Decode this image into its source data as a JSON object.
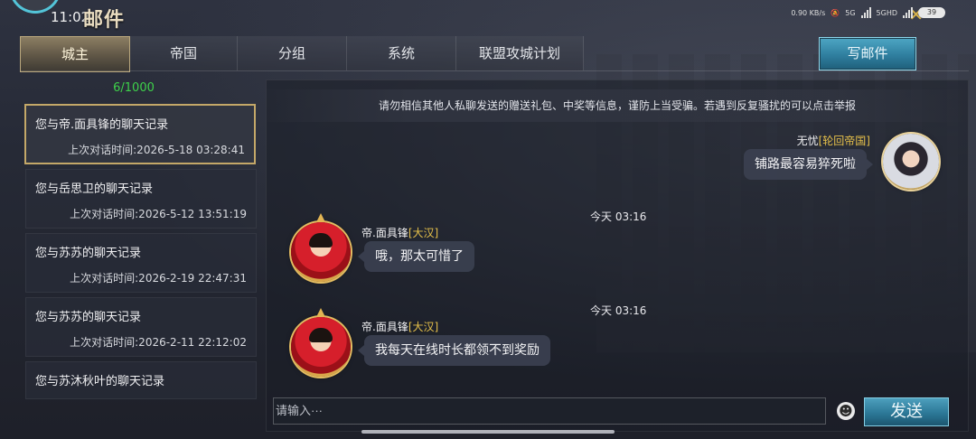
{
  "status_bar": {
    "time": "11:02",
    "net_speed": "0.90 KB/s",
    "net_5g": "5G",
    "net_5g_hd": "5GHD",
    "battery": "39"
  },
  "app": {
    "title": "邮件"
  },
  "tabs": [
    {
      "label": "城主",
      "active": true
    },
    {
      "label": "帝国",
      "active": false
    },
    {
      "label": "分组",
      "active": false
    },
    {
      "label": "系统",
      "active": false
    },
    {
      "label": "联盟攻城计划",
      "active": false
    }
  ],
  "write_mail_label": "写邮件",
  "mail_count": "6/1000",
  "threads": [
    {
      "title": "您与帝.面具锋的聊天记录",
      "time": "上次对话时间:2026-5-18   03:28:41",
      "active": true
    },
    {
      "title": "您与岳思卫的聊天记录",
      "time": "上次对话时间:2026-5-12   13:51:19",
      "active": false
    },
    {
      "title": "您与苏苏的聊天记录",
      "time": "上次对话时间:2026-2-19   22:47:31",
      "active": false
    },
    {
      "title": "您与苏苏的聊天记录",
      "time": "上次对话时间:2026-2-11   22:12:02",
      "active": false
    },
    {
      "title": "您与苏沐秋叶的聊天记录",
      "time": "",
      "active": false
    }
  ],
  "notice": "请勿相信其他人私聊发送的赠送礼包、中奖等信息，谨防上当受骗。若遇到反复骚扰的可以点击举报",
  "messages": [
    {
      "timestamp": "今天 03:16",
      "sender": "无忧",
      "tag": "[轮回帝国]",
      "text": "铺路最容易猝死啦",
      "side": "right"
    },
    {
      "timestamp": "今天 03:16",
      "sender": "帝.面具锋",
      "tag": "[大汉]",
      "text": "哦，那太可惜了",
      "side": "left"
    },
    {
      "timestamp": "今天 03:16",
      "sender": "帝.面具锋",
      "tag": "[大汉]",
      "text": "我每天在线时长都领不到奖励",
      "side": "left"
    }
  ],
  "input": {
    "placeholder": "请输入···",
    "value": ""
  },
  "send_label": "发送",
  "emoji_icon": "emoji-icon",
  "colors": {
    "accent_gold": "#c4a868",
    "button_blue": "#2f7f9f",
    "count_green": "#3ed14a",
    "tag_yellow": "#e6c04a"
  }
}
